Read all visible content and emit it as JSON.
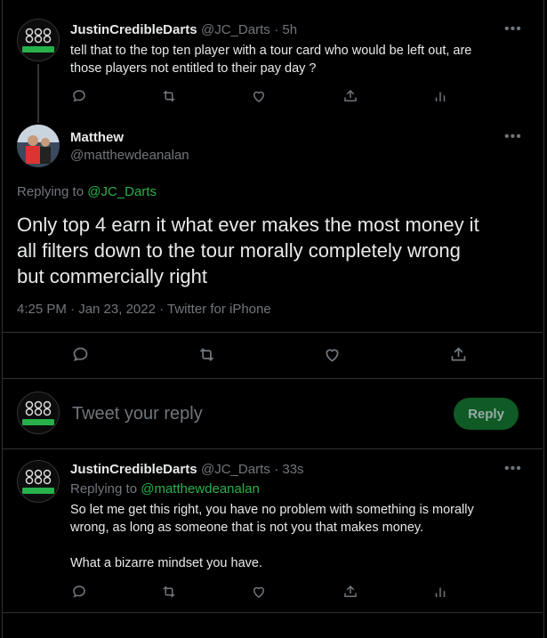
{
  "tweet1": {
    "name": "JustinCredibleDarts",
    "handle": "@JC_Darts",
    "time": "· 5h",
    "text_line1": "tell that to the top ten player with a tour card who would be left out, are",
    "text_line2": "those players not entitled to their pay day ?",
    "more": "•••"
  },
  "main_tweet": {
    "name": "Matthew",
    "handle": "@matthewdeanalan",
    "replying_prefix": "Replying to ",
    "replying_handle": "@JC_Darts",
    "text_line1": "Only top 4 earn it what ever makes the most money it",
    "text_line2": "all filters down to the tour morally completely wrong",
    "text_line3": "but commercially right",
    "meta": "4:25 PM · Jan 23, 2022 · Twitter for iPhone",
    "more": "•••"
  },
  "composer": {
    "placeholder": "Tweet your reply",
    "reply_label": "Reply"
  },
  "tweet3": {
    "name": "JustinCredibleDarts",
    "handle": "@JC_Darts",
    "time": "· 33s",
    "replying_prefix": "Replying to ",
    "replying_handle": "@matthewdeanalan",
    "text_line1": "So let me get this right, you have no problem with something is morally",
    "text_line2": "wrong, as long as someone that is not you that makes money.",
    "text_line3": "What a bizarre mindset you have.",
    "more": "•••"
  },
  "colors": {
    "accent": "#27b14a",
    "background": "#000000",
    "text": "#e7e9ea",
    "muted": "#71767b"
  },
  "icons": [
    "reply-icon",
    "retweet-icon",
    "like-icon",
    "share-icon",
    "analytics-icon",
    "more-icon"
  ]
}
